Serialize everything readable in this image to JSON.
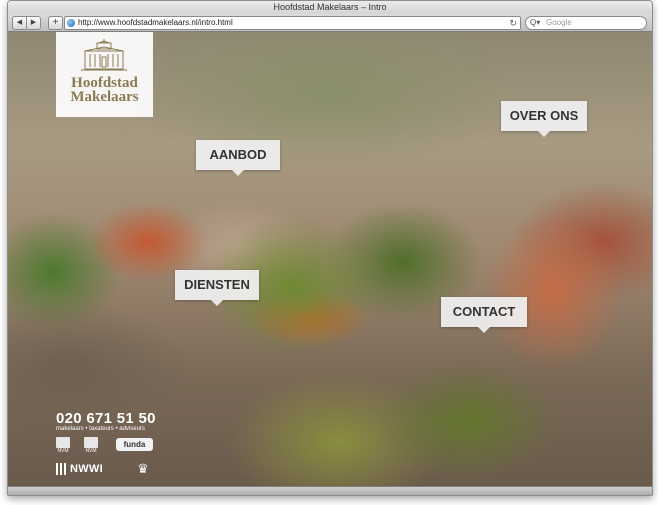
{
  "window": {
    "title": "Hoofdstad Makelaars – Intro"
  },
  "toolbar": {
    "back_glyph": "◀",
    "forward_glyph": "▶",
    "add_glyph": "+",
    "url": "http://www.hoofdstadmakelaars.nl/intro.html",
    "reload_glyph": "↻",
    "search_placeholder": "Google",
    "search_glyph": "Q▾"
  },
  "logo": {
    "line1": "Hoofdstad",
    "line2": "Makelaars",
    "color": "#8a7a55"
  },
  "nav": {
    "over_ons": "OVER ONS",
    "aanbod": "AANBOD",
    "diensten": "DIENSTEN",
    "contact": "CONTACT"
  },
  "footer": {
    "phone": "020 671 51 50",
    "tagline": "makelaars • taxateurs • adviseurs",
    "badge_nvm_1": "NVM",
    "badge_nvm_2": "NVM",
    "badge_funda": "funda",
    "badge_nwwi": "NWWI",
    "crown_glyph": "♛"
  },
  "icons": [
    "globe-icon",
    "reload-icon",
    "search-icon",
    "building-logo-icon",
    "crown-icon"
  ]
}
